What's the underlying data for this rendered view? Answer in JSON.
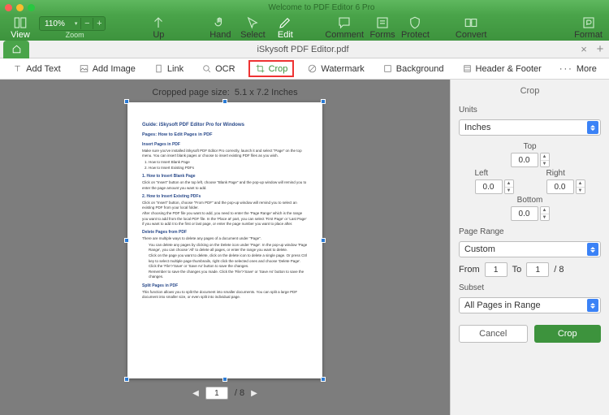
{
  "titlebar": {
    "title": "Welcome to PDF Editor 6 Pro"
  },
  "maintoolbar": {
    "view": "View",
    "zoom": "Zoom",
    "zoom_value": "110%",
    "up": "Up",
    "hand": "Hand",
    "select": "Select",
    "edit": "Edit",
    "comment": "Comment",
    "forms": "Forms",
    "protect": "Protect",
    "convert": "Convert",
    "format": "Format"
  },
  "filetab": {
    "filename": "iSkysoft PDF Editor.pdf"
  },
  "edittoolbar": {
    "add_text": "Add Text",
    "add_image": "Add Image",
    "link": "Link",
    "ocr": "OCR",
    "crop": "Crop",
    "watermark": "Watermark",
    "background": "Background",
    "header_footer": "Header & Footer",
    "more": "More"
  },
  "canvas": {
    "readout_label": "Cropped page size:",
    "readout_value": "5.1 x 7.2   Inches",
    "pager": {
      "current": "1",
      "total": "/  8"
    }
  },
  "doc": {
    "h1": "Guide: iSkysoft PDF Editor Pro for Windows",
    "h2a": "Pages:   How to Edit Pages in PDF",
    "h3a": "Insert Pages in PDF",
    "p1": "Make sure you've installed iSkysoft PDF Editor Pro correctly, launch it and select \"Page\" on the top menu. You can insert blank pages or choose to insert existing PDF files as you wish.",
    "li1": "How to Insert Blank Page",
    "li2": "How to Insert Existing PDFs",
    "h3b": "1.   How to Insert Blank Page",
    "p2": "Click on \"Insert\" button on the top left, choose \"Blank Page\" and the pop-up window will remind you to enter the page amount you want to add.",
    "h3c": "2.   How to Insert Existing PDFs",
    "p3": "Click on \"Insert\" button, choose \"From PDF\" and the pop-up window will remind you to select an existing PDF from your local folder.",
    "p4": "After choosing the PDF file you want to add, you need to enter the 'Page Range' which is the range you want to add from the local PDF file. In the 'Place at' part, you can select 'First Page' or 'Last Page' if you want to add it to the first or last page, or enter the page number you want to place after.",
    "h3d": "Delete Pages from PDF",
    "p5": "There are multiple ways to delete any pages of a document under \"Page\".",
    "dli1": "You can delete any pages by clicking on the Delete icon under 'Page'. In the pop-up window 'Page Range', you can choose 'All' to delete all pages, or enter the range you want to delete.",
    "dli2": "Click on the page you want to delete, click on the delete icon to delete a single page. Or press Ctrl key to select multiple page thumbnails, right click the selected ones and choose 'Delete Page'. Click the 'File'>'Save' or 'Save As' button to save the changes.",
    "dli3": "Remember to save the changes you made. Click the 'File'>'Save' or 'Save As' button to save the changes.",
    "h3e": "Split Pages in PDF",
    "p6": "This function allows you to split the document into smaller documents. You can split a large PDF document into smaller size, or even split into individual page."
  },
  "side": {
    "title": "Crop",
    "units_label": "Units",
    "units_value": "Inches",
    "top": "Top",
    "left": "Left",
    "right": "Right",
    "bottom": "Bottom",
    "val_top": "0.0",
    "val_left": "0.0",
    "val_right": "0.0",
    "val_bottom": "0.0",
    "pagerange_label": "Page Range",
    "pagerange_value": "Custom",
    "from": "From",
    "from_val": "1",
    "to": "To",
    "to_val": "1",
    "of": "/ 8",
    "subset_label": "Subset",
    "subset_value": "All Pages in Range",
    "cancel": "Cancel",
    "crop": "Crop"
  }
}
